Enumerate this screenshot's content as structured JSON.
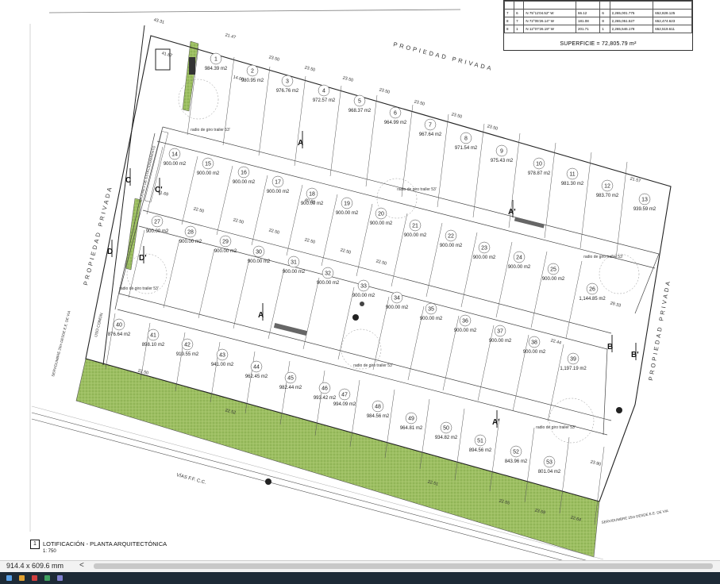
{
  "plan": {
    "title": "LOTIFICACIÓN - PLANTA ARQUITECTÓNICA",
    "scale": "1: 750",
    "view_number": "1",
    "superficie": "SUPERFICIE = 72,805.79 m²",
    "property_labels": {
      "top": "PROPIEDAD PRIVADA",
      "left": "PROPIEDAD PRIVADA",
      "right": "PROPIEDAD PRIVADA"
    },
    "road_label": "VÍAS F.F. C.C.",
    "uso_comun": "USO COMÚN",
    "servidumbre_left": "SERVIDUMBRE 25m DESDE E.E. DE VIA",
    "servidumbre_right": "SERVIDUMBRE 25m DESDE E.E. DE VIA",
    "estacionamiento": "CAJONES DE ESTACIONAMIENTO",
    "radio_label": "radio de giro trailer 53'",
    "top_dims": [
      "43.31",
      "21.47",
      "23.50",
      "23.50",
      "23.50",
      "23.50",
      "23.50",
      "23.50",
      "23.50",
      "21.57"
    ],
    "row_dims": [
      "22.50",
      "22.50",
      "22.50",
      "22.50",
      "22.50",
      "22.50",
      "22.50",
      "22.52",
      "22.51",
      "22.55",
      "23.59",
      "22.64",
      "23.90",
      "22.44",
      "29.33",
      "14.00",
      "41.87",
      "41.69",
      "40.00",
      "39.26"
    ]
  },
  "coord_table": {
    "rows": [
      [
        "7",
        "6",
        "N 75°11'04.52\" W",
        "66.12",
        "6",
        "2,265,001.775",
        "652,828.125"
      ],
      [
        "8",
        "7",
        "N 72°05'26.14\" W",
        "181.08",
        "8",
        "2,265,051.527",
        "652,474.623"
      ],
      [
        "8",
        "1",
        "N 12°07'26.19\" W",
        "201.71",
        "1",
        "2,265,546.178",
        "652,519.611"
      ]
    ]
  },
  "sections": [
    "A",
    "A'",
    "B",
    "B'",
    "C",
    "C'",
    "D",
    "D'"
  ],
  "lots": [
    {
      "n": "1",
      "a": "984.39 m2"
    },
    {
      "n": "2",
      "a": "980.95 m2"
    },
    {
      "n": "3",
      "a": "976.76 m2"
    },
    {
      "n": "4",
      "a": "972.57 m2"
    },
    {
      "n": "5",
      "a": "968.37 m2"
    },
    {
      "n": "6",
      "a": "964.99 m2"
    },
    {
      "n": "7",
      "a": "967.64 m2"
    },
    {
      "n": "8",
      "a": "971.54 m2"
    },
    {
      "n": "9",
      "a": "975.43 m2"
    },
    {
      "n": "10",
      "a": "978.87 m2"
    },
    {
      "n": "11",
      "a": "981.30 m2"
    },
    {
      "n": "12",
      "a": "983.70 m2"
    },
    {
      "n": "13",
      "a": "939.59 m2"
    },
    {
      "n": "14",
      "a": "900.00 m2"
    },
    {
      "n": "15",
      "a": "900.00 m2"
    },
    {
      "n": "16",
      "a": "900.00 m2"
    },
    {
      "n": "17",
      "a": "900.00 m2"
    },
    {
      "n": "18",
      "a": "900.00 m2"
    },
    {
      "n": "19",
      "a": "900.00 m2"
    },
    {
      "n": "20",
      "a": "900.00 m2"
    },
    {
      "n": "21",
      "a": "900.00 m2"
    },
    {
      "n": "22",
      "a": "900.00 m2"
    },
    {
      "n": "23",
      "a": "900.00 m2"
    },
    {
      "n": "24",
      "a": "900.00 m2"
    },
    {
      "n": "25",
      "a": "900.00 m2"
    },
    {
      "n": "26",
      "a": "1,144.85 m2"
    },
    {
      "n": "27",
      "a": "900.00 m2"
    },
    {
      "n": "28",
      "a": "900.00 m2"
    },
    {
      "n": "29",
      "a": "900.00 m2"
    },
    {
      "n": "30",
      "a": "900.00 m2"
    },
    {
      "n": "31",
      "a": "900.00 m2"
    },
    {
      "n": "32",
      "a": "900.00 m2"
    },
    {
      "n": "33",
      "a": "900.00 m2"
    },
    {
      "n": "34",
      "a": "900.00 m2"
    },
    {
      "n": "35",
      "a": "900.00 m2"
    },
    {
      "n": "36",
      "a": "900.00 m2"
    },
    {
      "n": "37",
      "a": "900.00 m2"
    },
    {
      "n": "38",
      "a": "900.00 m2"
    },
    {
      "n": "39",
      "a": "1,197.19 m2"
    },
    {
      "n": "40",
      "a": "876.64 m2"
    },
    {
      "n": "41",
      "a": "898.10 m2"
    },
    {
      "n": "42",
      "a": "919.55 m2"
    },
    {
      "n": "43",
      "a": "941.00 m2"
    },
    {
      "n": "44",
      "a": "962.45 m2"
    },
    {
      "n": "45",
      "a": "982.44 m2"
    },
    {
      "n": "46",
      "a": "993.42 m2"
    },
    {
      "n": "47",
      "a": "994.09 m2"
    },
    {
      "n": "48",
      "a": "984.56 m2"
    },
    {
      "n": "49",
      "a": "964.81 m2"
    },
    {
      "n": "50",
      "a": "934.82 m2"
    },
    {
      "n": "51",
      "a": "894.56 m2"
    },
    {
      "n": "52",
      "a": "843.96 m2"
    },
    {
      "n": "53",
      "a": "801.04 m2"
    }
  ],
  "statusbar": {
    "size": "914.4 x 609.6 mm",
    "arrow": "<"
  },
  "colors": {
    "green": "#9dbf62",
    "line": "#3a3a3a",
    "taskbar": "#1d2a36"
  }
}
